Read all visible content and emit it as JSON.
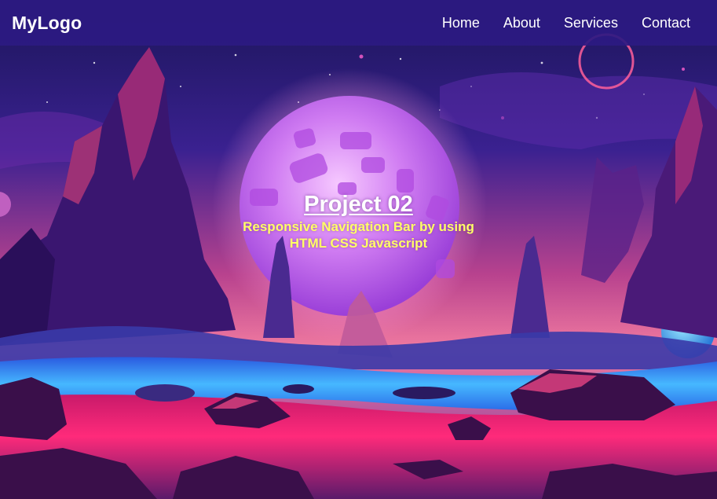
{
  "navbar": {
    "logo": "MyLogo",
    "links": [
      {
        "label": "Home"
      },
      {
        "label": "About"
      },
      {
        "label": "Services"
      },
      {
        "label": "Contact"
      }
    ]
  },
  "hero": {
    "title": "Project 02",
    "subtitle_line1": "Responsive Navigation Bar by using",
    "subtitle_line2": "HTML CSS Javascript"
  },
  "colors": {
    "navbar_bg": "#2c1a82",
    "title_text": "#ffffff",
    "subtitle_text": "#ffff66",
    "sky_top": "#1e1660",
    "planet": "#c86cf0",
    "ground_pink": "#ff2a7a",
    "water_blue": "#3aa4ff"
  },
  "background": {
    "description_icon": "alien-landscape-illustration"
  }
}
